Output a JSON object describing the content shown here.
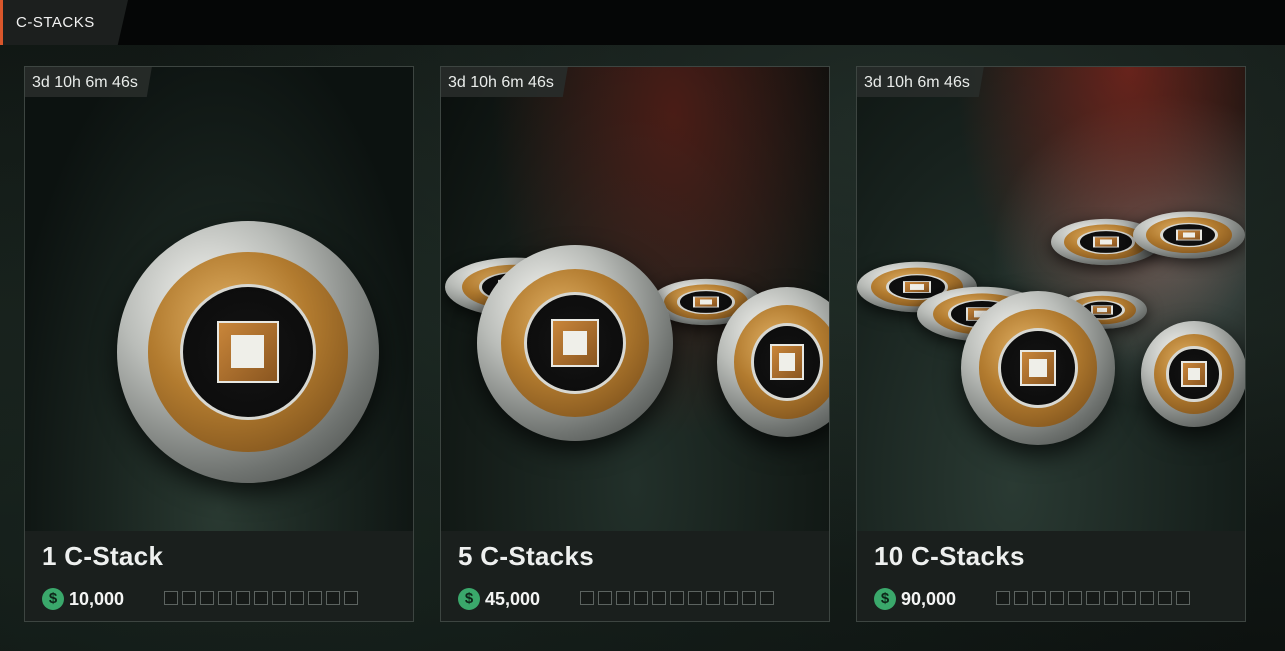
{
  "topbar": {
    "tab_label": "C-STACKS",
    "accent_color": "#d9562b"
  },
  "cards": [
    {
      "timer": "3d 10h 6m 46s",
      "name": "1 C-Stack",
      "price": "10,000",
      "currency_icon": "dollar-coin-icon",
      "currency_color": "#3aa86b"
    },
    {
      "timer": "3d 10h 6m 46s",
      "name": "5 C-Stacks",
      "price": "45,000",
      "currency_icon": "dollar-coin-icon",
      "currency_color": "#3aa86b"
    },
    {
      "timer": "3d 10h 6m 46s",
      "name": "10 C-Stacks",
      "price": "90,000",
      "currency_icon": "dollar-coin-icon",
      "currency_color": "#3aa86b"
    }
  ],
  "currency_symbol": "$"
}
